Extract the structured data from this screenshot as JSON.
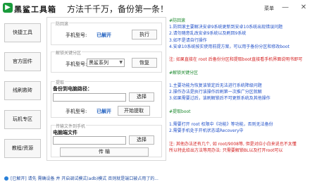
{
  "app": {
    "logo_glyph": "▶",
    "title": "黑鲨工具箱",
    "slogan": "方法千千万，备份第一条！",
    "menu_label": "菜单",
    "minimize_glyph": "—",
    "close_glyph": "✕",
    "accent_color": "#1a9b3c"
  },
  "sidebar": {
    "items": [
      {
        "label": "快捷工具"
      },
      {
        "label": "官方固件"
      },
      {
        "label": "线刷救砖"
      },
      {
        "label": "玩机专区"
      },
      {
        "label": "教程/资源"
      }
    ]
  },
  "panel": {
    "group1": {
      "title": "防回滚",
      "phone_label": "手机型号:",
      "phone_value": "已解开",
      "exec_button": "执行"
    },
    "group2": {
      "title": "解锁关键分区",
      "phone_label": "手机型号:",
      "model_select": "黑鲨系列",
      "restore_button": "恢复"
    },
    "group3": {
      "title": "提取",
      "backup_label": "备份到电脑路径：",
      "choose_button": "选择",
      "phone_label": "手机型号:",
      "phone_value": "已解开",
      "start_button": "开始提取"
    },
    "group4": {
      "title": "传输文件到手机",
      "file_label": "电脑端文件",
      "choose_button": "选择",
      "transfer_button": "传 输"
    }
  },
  "info": {
    "lines": [
      {
        "text": "#防回滚",
        "color": "green"
      },
      {
        "text": "1.防回滚主要解决安卓9系统更新到安卓10系统出现错误问题",
        "color": "blue"
      },
      {
        "text": "2.请勿随意乱改安卓9系统以及刷回9系统",
        "color": "blue"
      },
      {
        "text": "3.如不是请自行操作",
        "color": "blue"
      },
      {
        "text": "4.安卓10系统按实使用前提方案，可以用于备份分区和修改boot",
        "color": "blue"
      },
      {
        "text": "",
        "color": "blue"
      },
      {
        "text": "注: 如果直接在 root 后备份分区和提取boot直接看手机界面说明书即可",
        "color": "red"
      },
      {
        "text": "",
        "color": "blue"
      },
      {
        "text": "#解锁关键分区",
        "color": "green"
      },
      {
        "text": "",
        "color": "blue"
      },
      {
        "text": "1.主要功能为恢复该锁定后无法进行系统降级问题",
        "color": "blue"
      },
      {
        "text": "2.操作办法是执行该操作后刷第一次推广分区就解",
        "color": "blue"
      },
      {
        "text": "3.如果需要过后，该刷解锁后不可更新系统及其他操作",
        "color": "blue"
      },
      {
        "text": "",
        "color": "blue"
      },
      {
        "text": "#提取boot",
        "color": "green"
      },
      {
        "text": "",
        "color": "blue"
      },
      {
        "text": "1.需要打开 root 权限中《功能》等功能，否则无法备份",
        "color": "blue"
      },
      {
        "text": "2.需要手机处于开机状态或Recovery中",
        "color": "blue"
      },
      {
        "text": "",
        "color": "blue"
      },
      {
        "text": "注: 其他办法还有几个, 如 root/9008等, 但是对应小白来说也不太懂",
        "color": "red"
      },
      {
        "text": "所以特此给出方法等用办法: 只需要解锁BL以及打开root可以",
        "color": "red"
      }
    ]
  },
  "status": {
    "text": "[已解开] 请先 需确设备 并 开启调试模式(adb)模式 否则就是端口被占用了的..."
  }
}
